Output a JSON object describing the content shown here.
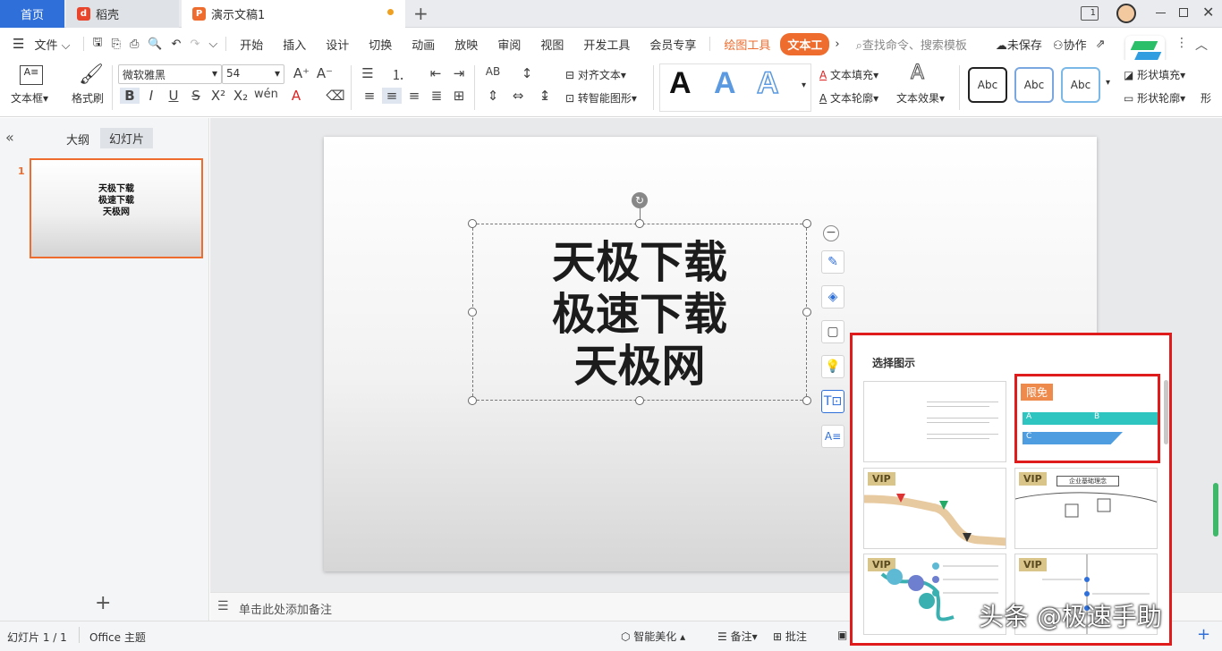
{
  "tabs": {
    "home": "首页",
    "daoke": "稻壳",
    "doc": "演示文稿1",
    "add": "+",
    "page_indicator": "1"
  },
  "menu": {
    "file": "文件",
    "items": [
      "开始",
      "插入",
      "设计",
      "切换",
      "动画",
      "放映",
      "审阅",
      "视图",
      "开发工具",
      "会员专享"
    ],
    "draw_tools": "绘图工具",
    "text_tools": "文本工",
    "search_placeholder": "查找命令、搜索模板",
    "unsaved": "未保存",
    "collab": "协作"
  },
  "ribbon": {
    "textbox": "文本框",
    "format_painter": "格式刷",
    "font_name": "微软雅黑",
    "font_size": "54",
    "align_text": "对齐文本",
    "smart_shape": "转智能图形",
    "text_fill": "文本填充",
    "text_outline": "文本轮廓",
    "text_effect": "文本效果",
    "shape_fill": "形状填充",
    "shape_outline": "形状轮廓",
    "style_sample": "Abc",
    "wordart_sample": "A",
    "more": "形"
  },
  "left": {
    "outline_tab": "大纲",
    "slides_tab": "幻灯片",
    "slide_number": "1",
    "thumb_lines": [
      "天极下载",
      "极速下载",
      "天极网"
    ],
    "add": "+"
  },
  "slide": {
    "lines": [
      "天极下载",
      "极速下载",
      "天极网"
    ]
  },
  "notes": {
    "placeholder": "单击此处添加备注"
  },
  "popup": {
    "title": "选择图示",
    "free_badge": "限免",
    "vip_badge": "VIP",
    "letters": [
      "A",
      "B",
      "C"
    ],
    "banner_text": "企业基础理念"
  },
  "status": {
    "slide_info": "幻灯片 1 / 1",
    "theme": "Office 主题",
    "beautify": "智能美化",
    "notes": "备注",
    "comment": "批注"
  },
  "watermark": "头条 @极速手助",
  "colors": {
    "accent_blue": "#2f6fd9",
    "tab_orange": "#ee6c2d",
    "highlight_red": "#e01b1b",
    "teal": "#2ec4c0",
    "blue_shape": "#4d9de0"
  }
}
